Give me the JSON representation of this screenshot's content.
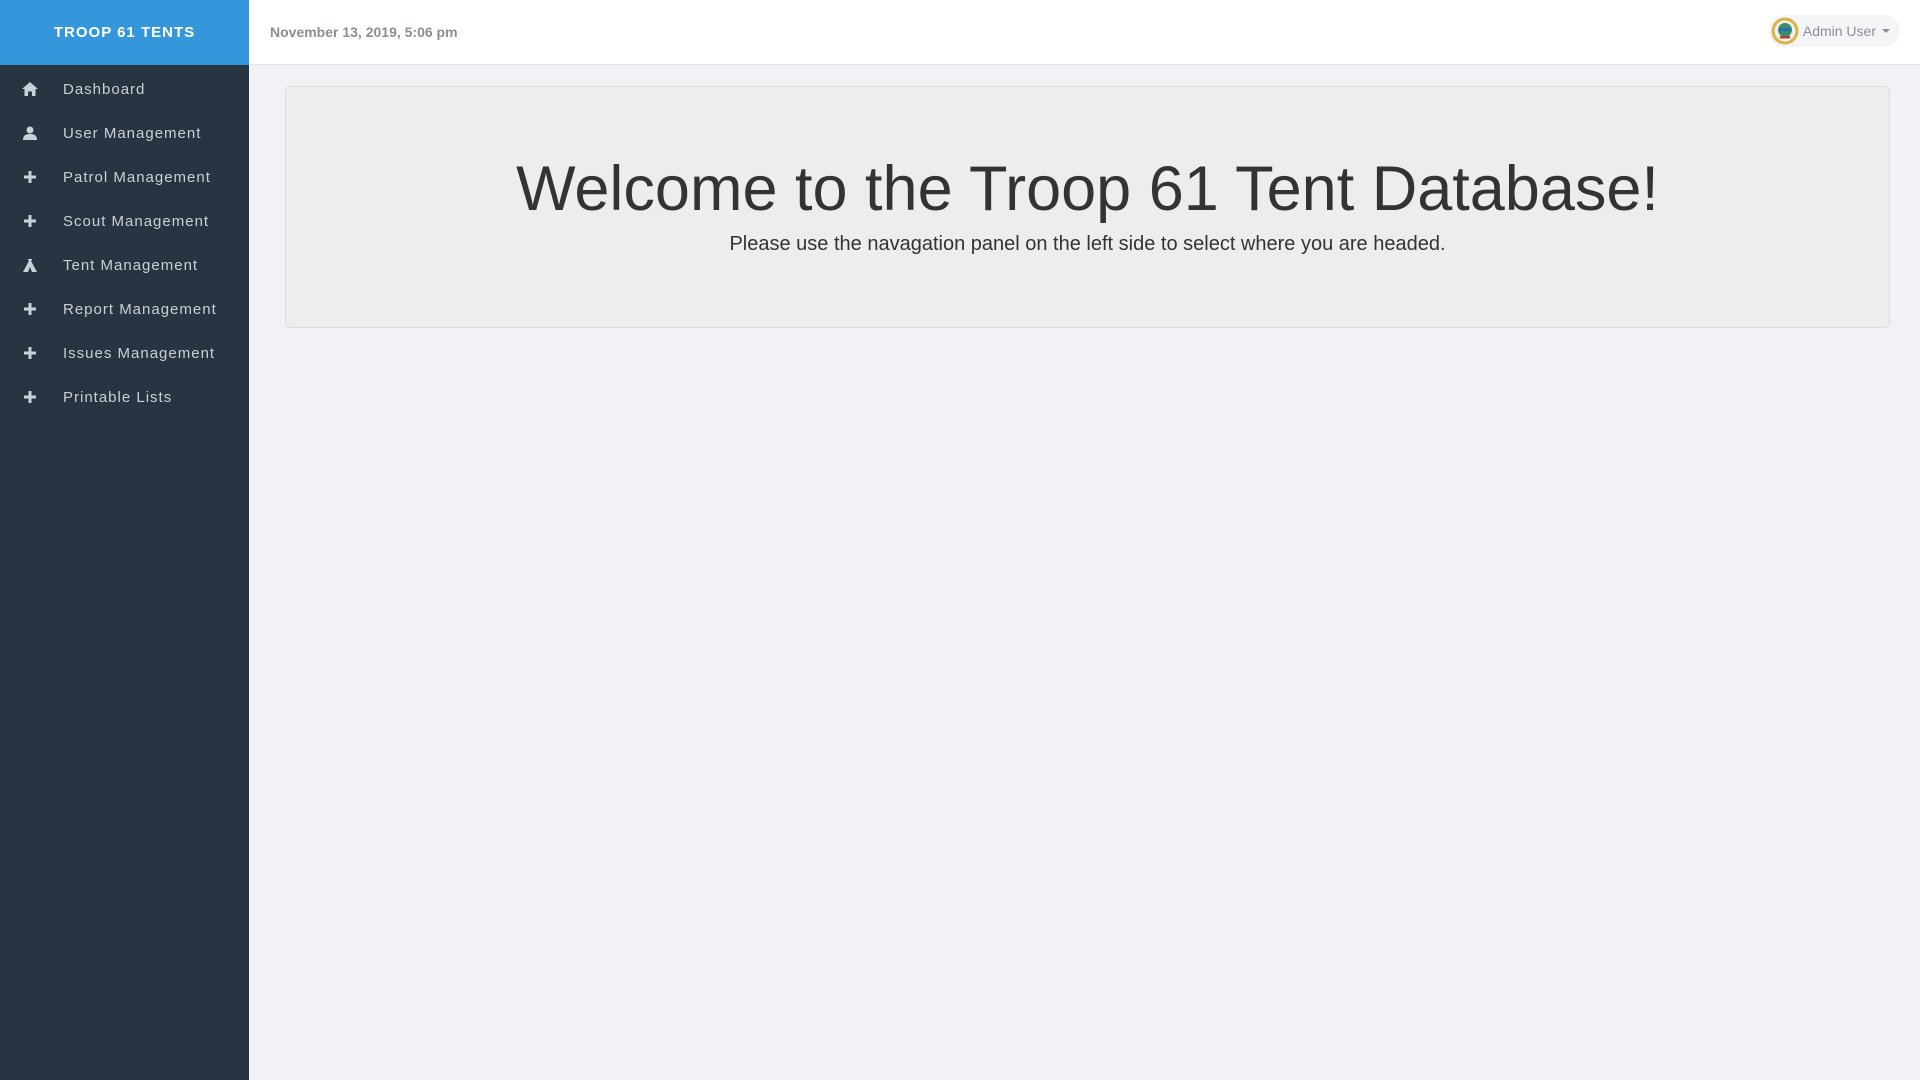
{
  "app": {
    "brand": "TROOP 61 TENTS"
  },
  "sidebar": {
    "items": [
      {
        "label": "Dashboard",
        "icon": "home-icon"
      },
      {
        "label": "User Management",
        "icon": "user-icon"
      },
      {
        "label": "Patrol Management",
        "icon": "plus-icon"
      },
      {
        "label": "Scout Management",
        "icon": "plus-icon"
      },
      {
        "label": "Tent Management",
        "icon": "tent-icon"
      },
      {
        "label": "Report Management",
        "icon": "plus-icon"
      },
      {
        "label": "Issues Management",
        "icon": "plus-icon"
      },
      {
        "label": "Printable Lists",
        "icon": "plus-icon"
      }
    ]
  },
  "header": {
    "date": "November 13, 2019, 5:06 pm",
    "user_name": "Admin User"
  },
  "main": {
    "title": "Welcome to the Troop 61 Tent Database!",
    "subtitle": "Please use the navagation panel on the left side to select where you are headed."
  },
  "colors": {
    "brand_bg": "#3497dc",
    "sidebar_bg": "#283442",
    "page_bg": "#f0f2f6",
    "panel_bg": "#ededed"
  }
}
